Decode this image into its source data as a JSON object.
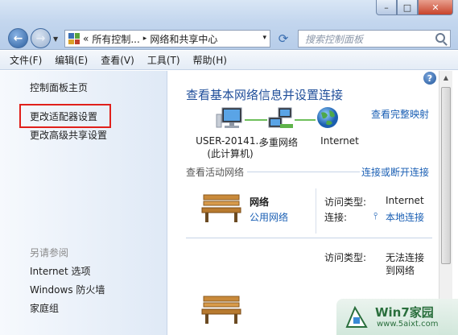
{
  "window": {
    "controls": {
      "minimize": "–",
      "maximize": "□",
      "close": "✕"
    }
  },
  "address_bar": {
    "prefix": "«",
    "segments": [
      "所有控制...",
      "网络和共享中心"
    ],
    "separator": "▸",
    "dropdown": "▾"
  },
  "search": {
    "placeholder": "搜索控制面板"
  },
  "menu": [
    "文件(F)",
    "编辑(E)",
    "查看(V)",
    "工具(T)",
    "帮助(H)"
  ],
  "sidebar": {
    "home": "控制面板主页",
    "change_adapter": "更改适配器设置",
    "change_sharing": "更改高级共享设置",
    "see_also_title": "另请参阅",
    "see_also": [
      "Internet 选项",
      "Windows 防火墙",
      "家庭组"
    ]
  },
  "main": {
    "title": "查看基本网络信息并设置连接",
    "full_map_link": "查看完整映射",
    "nodes": {
      "computer": [
        "USER-20141...",
        "(此计算机)"
      ],
      "network": "多重网络",
      "internet": "Internet"
    },
    "active_section": "查看活动网络",
    "connect_link": "连接或断开连接",
    "network1": {
      "name": "网络",
      "type": "公用网络",
      "access_label": "访问类型:",
      "access_value": "Internet",
      "conn_label": "连接:",
      "conn_value": "本地连接"
    },
    "network2": {
      "access_label": "访问类型:",
      "access_value": [
        "无法连接",
        "到网络"
      ]
    }
  },
  "help_icon": "?",
  "watermark": {
    "title": "Win7家园",
    "url": "www.5aixt.com"
  },
  "colors": {
    "accent": "#1a5fb4",
    "title_blue": "#1f4e9a",
    "highlight_red": "#e0201b"
  }
}
